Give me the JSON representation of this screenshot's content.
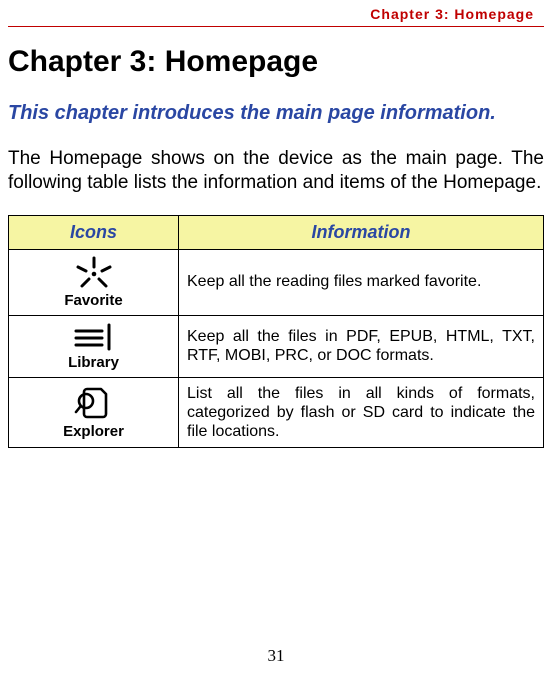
{
  "running_header": "Chapter 3: Homepage",
  "chapter_title": "Chapter 3: Homepage",
  "intro": "This chapter introduces the main page information.",
  "body": "The Homepage shows on the device as the main page. The following table lists the information and items of the Homepage.",
  "page_number": "31",
  "table": {
    "headers": {
      "icons": "Icons",
      "info": "Information"
    },
    "rows": [
      {
        "icon_name": "favorite-icon",
        "label": "Favorite",
        "info": "Keep all the reading files marked favorite."
      },
      {
        "icon_name": "library-icon",
        "label": "Library",
        "info": "Keep all the files in PDF, EPUB, HTML, TXT, RTF, MOBI, PRC, or DOC formats."
      },
      {
        "icon_name": "explorer-icon",
        "label": "Explorer",
        "info": "List all the files in all kinds of formats, categorized by flash or SD card to indicate the file locations."
      }
    ]
  }
}
